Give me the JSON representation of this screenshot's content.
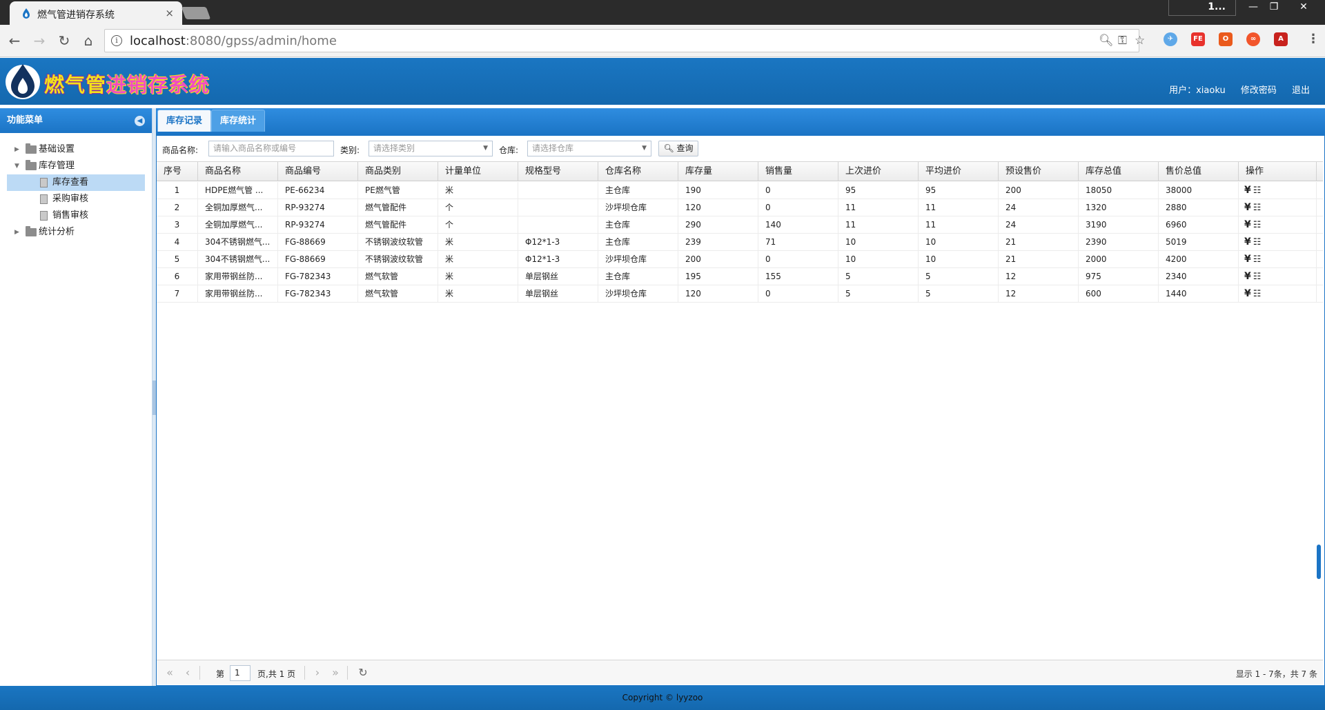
{
  "browser": {
    "tab_title": "燃气管进销存系统",
    "tab_close": "×",
    "profile_label": "1...",
    "url_host": "localhost",
    "url_rest": ":8080/gpss/admin/home",
    "window_controls": [
      "—",
      "❐",
      "✕"
    ]
  },
  "header": {
    "logo_part1": "燃气管",
    "logo_part2": "进销存系统",
    "user_label": "用户：xiaoku",
    "change_password": "修改密码",
    "logout": "退出"
  },
  "sidebar": {
    "title": "功能菜单",
    "items": [
      {
        "label": "基础设置",
        "level": 0,
        "type": "folder",
        "expanded": false
      },
      {
        "label": "库存管理",
        "level": 0,
        "type": "folder",
        "expanded": true
      },
      {
        "label": "库存查看",
        "level": 1,
        "type": "doc",
        "selected": true
      },
      {
        "label": "采购审核",
        "level": 1,
        "type": "doc"
      },
      {
        "label": "销售审核",
        "level": 1,
        "type": "doc"
      },
      {
        "label": "统计分析",
        "level": 0,
        "type": "folder",
        "expanded": false
      }
    ]
  },
  "main": {
    "tabs": [
      {
        "label": "库存记录",
        "active": true
      },
      {
        "label": "库存统计",
        "active": false
      }
    ]
  },
  "filter": {
    "name_label": "商品名称:",
    "name_placeholder": "请输入商品名称或编号",
    "category_label": "类别:",
    "category_placeholder": "请选择类别",
    "warehouse_label": "仓库:",
    "warehouse_placeholder": "请选择仓库",
    "query_button": "查询"
  },
  "table": {
    "columns": [
      "序号",
      "商品名称",
      "商品编号",
      "商品类别",
      "计量单位",
      "规格型号",
      "仓库名称",
      "库存量",
      "销售量",
      "上次进价",
      "平均进价",
      "预设售价",
      "库存总值",
      "售价总值",
      "操作"
    ],
    "rows": [
      [
        "1",
        "HDPE燃气管 ...",
        "PE-66234",
        "PE燃气管",
        "米",
        "",
        "主仓库",
        "190",
        "0",
        "95",
        "95",
        "200",
        "18050",
        "38000"
      ],
      [
        "2",
        "全铜加厚燃气...",
        "RP-93274",
        "燃气管配件",
        "个",
        "",
        "沙坪坝仓库",
        "120",
        "0",
        "11",
        "11",
        "24",
        "1320",
        "2880"
      ],
      [
        "3",
        "全铜加厚燃气...",
        "RP-93274",
        "燃气管配件",
        "个",
        "",
        "主仓库",
        "290",
        "140",
        "11",
        "11",
        "24",
        "3190",
        "6960"
      ],
      [
        "4",
        "304不锈钢燃气...",
        "FG-88669",
        "不锈钢波纹软管",
        "米",
        "Φ12*1-3",
        "主仓库",
        "239",
        "71",
        "10",
        "10",
        "21",
        "2390",
        "5019"
      ],
      [
        "5",
        "304不锈钢燃气...",
        "FG-88669",
        "不锈钢波纹软管",
        "米",
        "Φ12*1-3",
        "沙坪坝仓库",
        "200",
        "0",
        "10",
        "10",
        "21",
        "2000",
        "4200"
      ],
      [
        "6",
        "家用带钢丝防...",
        "FG-782343",
        "燃气软管",
        "米",
        "单层钢丝",
        "主仓库",
        "195",
        "155",
        "5",
        "5",
        "12",
        "975",
        "2340"
      ],
      [
        "7",
        "家用带钢丝防...",
        "FG-782343",
        "燃气软管",
        "米",
        "单层钢丝",
        "沙坪坝仓库",
        "120",
        "0",
        "5",
        "5",
        "12",
        "600",
        "1440"
      ]
    ],
    "op_price_icon": "¥",
    "op_config_icon": "☷"
  },
  "pager": {
    "page_prefix": "第",
    "page_value": "1",
    "page_suffix": "页,共 1 页",
    "info": "显示 1 - 7条，共 7 条"
  },
  "footer": {
    "copyright": "Copyright © lyyzoo"
  },
  "colors": {
    "brand_blue": "#1b74c5",
    "selected_row": "#bcdaf5"
  }
}
